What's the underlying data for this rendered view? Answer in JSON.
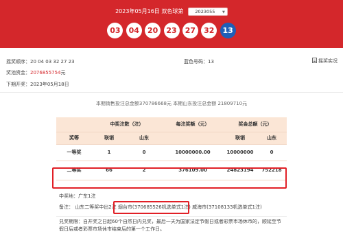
{
  "header": {
    "title": "2023年05月16日 双色球第",
    "issue": "2023055",
    "colors": {
      "brand_red": "#d4272b",
      "blue_ball": "#1f5eb8",
      "highlight_border": "#e11f26"
    }
  },
  "balls": {
    "red": [
      "03",
      "04",
      "20",
      "23",
      "27",
      "32"
    ],
    "blue": "13"
  },
  "info": {
    "order_label": "摇奖顺序：",
    "order_value": "20  04  03  32  27  23",
    "blue_label": "蓝色号码：",
    "blue_value": "13",
    "explain_label": "摇奖实况",
    "explain_icon": "document-icon",
    "pool_label": "奖池资金：",
    "pool_value": "2076855754",
    "pool_unit": "元",
    "next_label": "下期开奖：",
    "next_value": "2023年05月18日"
  },
  "totals": "本期销售投注总金额370786668元 本期山东投注总金额 21809710元",
  "table": {
    "header_count": "中奖注数（注）",
    "header_each": "每注奖额（元）",
    "header_total": "奖金总额（元）",
    "sub_level": "奖等",
    "sub_lian": "联销",
    "sub_shandong": "山东",
    "rows": [
      {
        "level": "一等奖",
        "lian": "1",
        "sd": "0",
        "each": "10000000.00",
        "total_lian": "10000000",
        "total_sd": "0"
      },
      {
        "level": "二等奖",
        "lian": "66",
        "sd": "2",
        "each": "376109.00",
        "total_lian": "24823194",
        "total_sd": "752218"
      }
    ]
  },
  "bottom": {
    "place": "中奖地：广东1注",
    "note": "备注：  山东二等奖中出2注 烟台市(370685526机选单式1注) 威海市(37108133机选单式1注)",
    "cash1": "兑奖期限：自开奖之日起60个自然日内兑奖，最后一天为国家法定节假日或者彩票市场休市的，顺延至节",
    "cash2": "假日后或者彩票市场休市结束后的第一个工作日。"
  }
}
